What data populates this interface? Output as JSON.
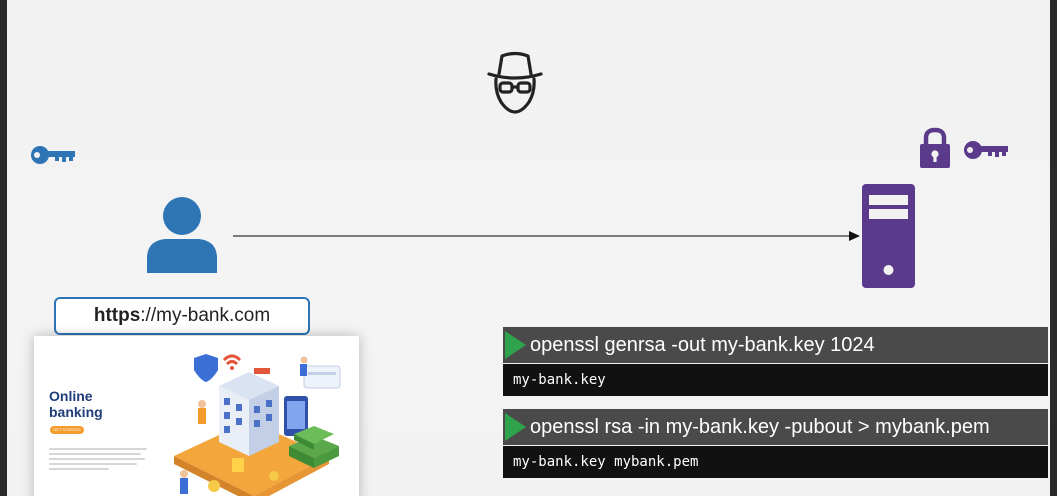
{
  "url": {
    "scheme": "https",
    "rest": "://my-bank.com"
  },
  "website": {
    "title_line1": "Online",
    "title_line2": "banking",
    "cta_label": "GET STARTED"
  },
  "terminal": [
    {
      "command": "openssl genrsa -out my-bank.key 1024",
      "output": "my-bank.key"
    },
    {
      "command": "openssl rsa -in my-bank.key -pubout > mybank.pem",
      "output": "my-bank.key mybank.pem"
    }
  ],
  "colors": {
    "user": "#2e75b6",
    "server": "#5b3a8c",
    "hacker": "#222222",
    "play": "#2ea34b"
  },
  "icons": {
    "user_key": "key-icon",
    "user": "user-icon",
    "hacker": "hacker-spy-icon",
    "server_lock": "lock-icon",
    "server_key": "key-icon",
    "server": "server-icon"
  }
}
